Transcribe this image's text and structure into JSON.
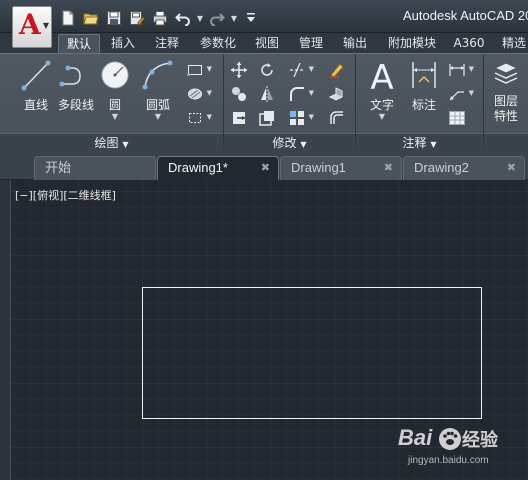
{
  "app": {
    "title": "Autodesk AutoCAD 20",
    "logo_letter": "A"
  },
  "quick_access": {
    "icons": [
      "new-icon",
      "open-icon",
      "save-icon",
      "save-as-icon",
      "plot-icon",
      "undo-icon",
      "redo-icon",
      "customize-icon"
    ]
  },
  "ribbon_tabs": [
    "默认",
    "插入",
    "注释",
    "参数化",
    "视图",
    "管理",
    "输出",
    "附加模块",
    "A360",
    "精选"
  ],
  "ribbon": {
    "draw": {
      "title": "绘图",
      "line": "直线",
      "polyline": "多段线",
      "circle": "圆",
      "arc": "圆弧"
    },
    "modify": {
      "title": "修改"
    },
    "annotation": {
      "title": "注释",
      "text": "文字",
      "dimension": "标注"
    },
    "layers": {
      "label_line1": "图层",
      "label_line2": "特性"
    }
  },
  "doc_tabs": [
    {
      "label": "开始"
    },
    {
      "label": "Drawing1*",
      "close": "✖"
    },
    {
      "label": "Drawing1",
      "close": "✖"
    },
    {
      "label": "Drawing2",
      "close": "✖"
    }
  ],
  "viewport": {
    "label": "[−][俯视][二维线框]"
  },
  "watermark": {
    "brand": "Bai",
    "brand2": "经验",
    "url": "jingyan.baidu.com"
  },
  "colors": {
    "canvas_bg": "#212830",
    "ribbon_bg": "#4b545d",
    "logo_red": "#c8141c"
  }
}
